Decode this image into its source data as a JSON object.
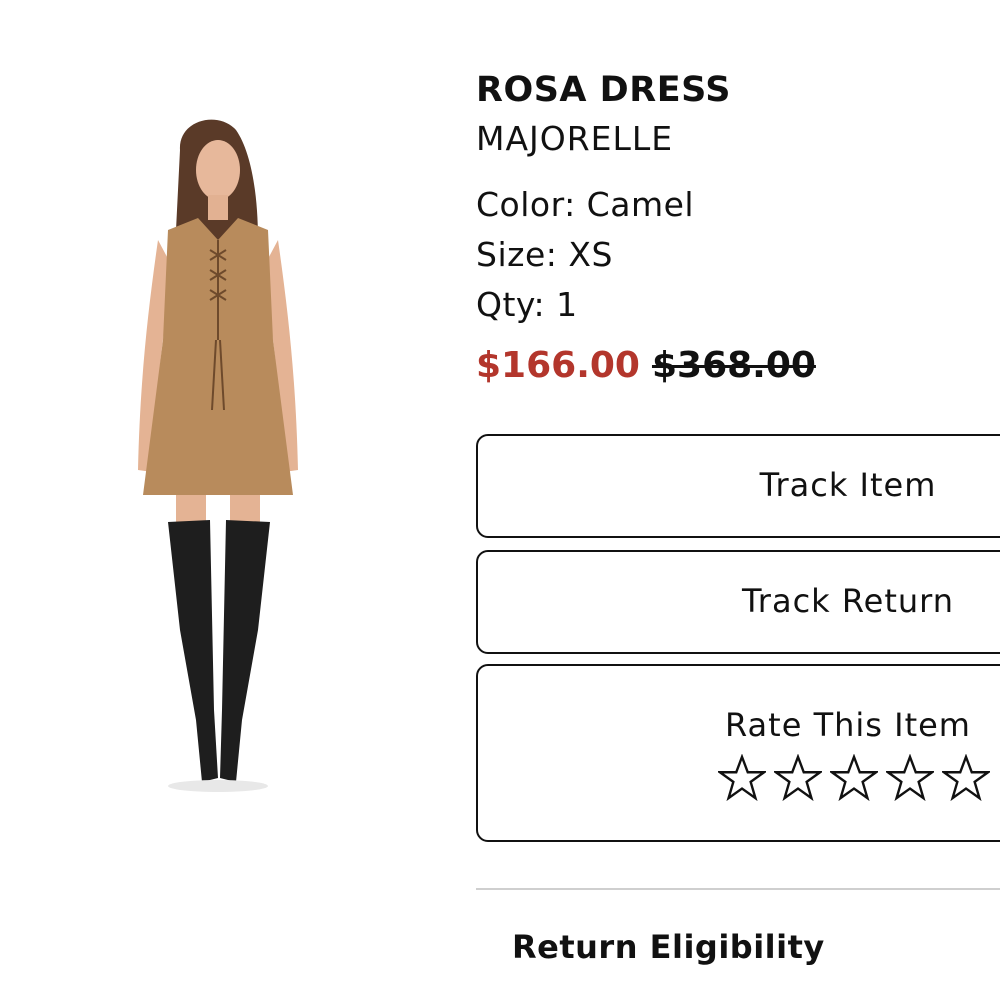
{
  "product": {
    "name": "ROSA DRESS",
    "brand": "MAJORELLE",
    "color": "Color: Camel",
    "size": "Size: XS",
    "qty": "Qty: 1",
    "sale_price": "$166.00",
    "original_price": "$368.00",
    "image_icon": "product-photo-model-in-camel-suede-dress"
  },
  "actions": {
    "track_item": "Track Item",
    "track_return": "Track Return",
    "rate_item": "Rate This Item",
    "rating": 0,
    "rating_max": 5
  },
  "return_section": {
    "title": "Return Eligibility"
  },
  "colors": {
    "sale_price": "#b3362c",
    "dress": "#b88b5c",
    "boots": "#1e1e1e"
  }
}
